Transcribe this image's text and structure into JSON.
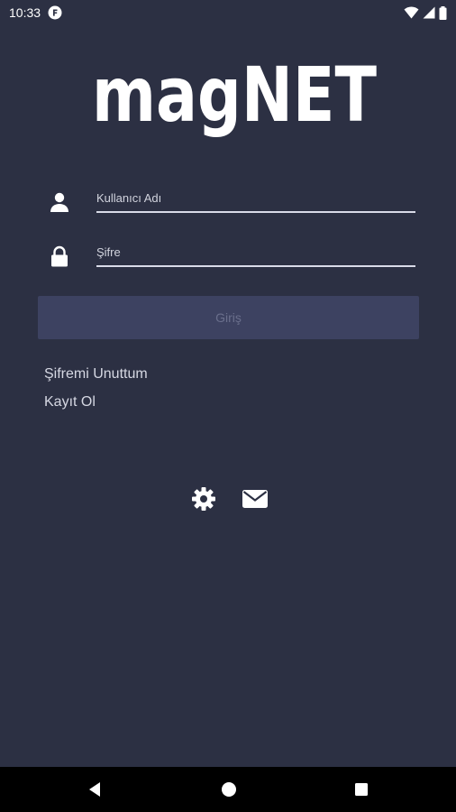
{
  "status_bar": {
    "time": "10:33",
    "notification_icon": "f-badge-icon",
    "icons": [
      "wifi-icon",
      "cellular-icon",
      "battery-icon"
    ]
  },
  "app": {
    "logo_text": "magNET"
  },
  "form": {
    "username_placeholder": "Kullanıcı Adı",
    "password_placeholder": "Şifre",
    "login_label": "Giriş"
  },
  "links": {
    "forgot_password": "Şifremi Unuttum",
    "register": "Kayıt Ol"
  },
  "footer_icons": [
    "gear-icon",
    "mail-icon"
  ],
  "nav_bar": [
    "back-icon",
    "home-icon",
    "recents-icon"
  ],
  "colors": {
    "background": "#2c3043",
    "button_bg": "#3d4261",
    "button_text": "#6a6f8c",
    "underline": "#d9dbe8"
  }
}
